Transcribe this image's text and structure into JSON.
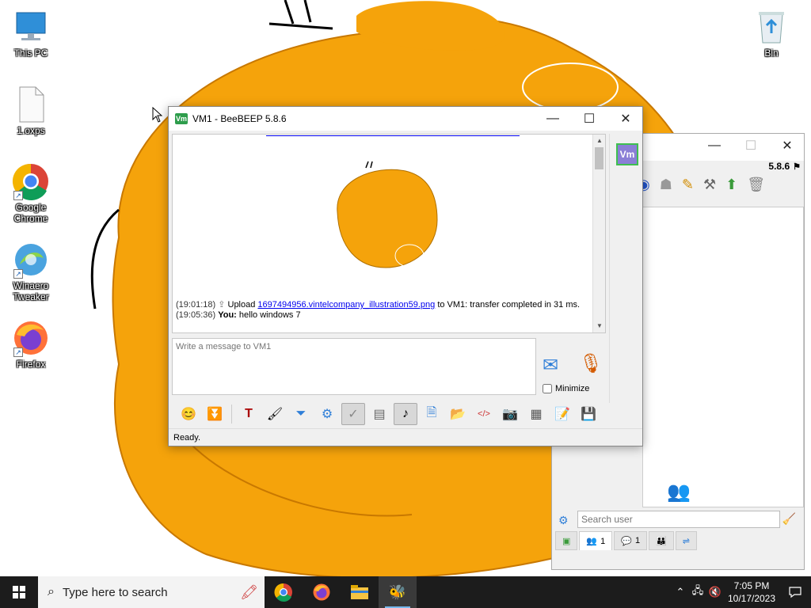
{
  "desktop": {
    "icons": [
      {
        "label": "This PC",
        "icon": "monitor-icon"
      },
      {
        "label": "1.oxps",
        "icon": "document-icon"
      },
      {
        "label": "Google Chrome",
        "icon": "chrome-icon"
      },
      {
        "label": "Winaero Tweaker",
        "icon": "winaero-icon"
      },
      {
        "label": "Firefox",
        "icon": "firefox-icon"
      },
      {
        "label": "Bin",
        "icon": "recycle-bin-icon"
      }
    ]
  },
  "chat_window": {
    "title": "VM1 - BeeBEEP 5.8.6",
    "app_badge": "Vm",
    "user_badge": "Vm",
    "messages": [
      {
        "time": "(19:01:18)",
        "prefix": "Upload",
        "link": "1697494956.vintelcompany_illustration59.png",
        "suffix": "to VM1: transfer completed in 31 ms."
      },
      {
        "time": "(19:05:36)",
        "sender": "You:",
        "text": "hello windows 7"
      }
    ],
    "message_placeholder": "Write a message to VM1",
    "minimize_label": "Minimize",
    "status": "Ready."
  },
  "users_window": {
    "version": "5.8.6",
    "search_placeholder": "Search user",
    "tabs": [
      {
        "icon": "network-icon",
        "count": ""
      },
      {
        "icon": "users-icon",
        "count": "1"
      },
      {
        "icon": "chat-icon",
        "count": "1"
      },
      {
        "icon": "groups-icon",
        "count": ""
      },
      {
        "icon": "share-icon",
        "count": ""
      }
    ]
  },
  "taskbar": {
    "search_placeholder": "Type here to search",
    "time": "7:05 PM",
    "date": "10/17/2023"
  },
  "colors": {
    "wallpaper_orange": "#f5a30b",
    "taskbar": "#1c1c1c",
    "link": "#0000ee"
  }
}
